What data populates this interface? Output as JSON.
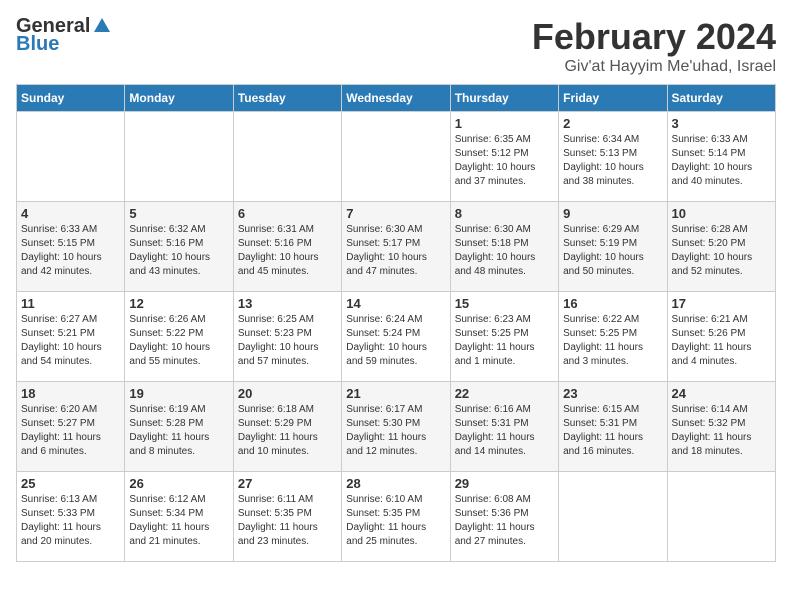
{
  "logo": {
    "general": "General",
    "blue": "Blue"
  },
  "title": {
    "month": "February 2024",
    "location": "Giv'at Hayyim Me'uhad, Israel"
  },
  "columns": [
    "Sunday",
    "Monday",
    "Tuesday",
    "Wednesday",
    "Thursday",
    "Friday",
    "Saturday"
  ],
  "weeks": [
    [
      {
        "day": "",
        "text": ""
      },
      {
        "day": "",
        "text": ""
      },
      {
        "day": "",
        "text": ""
      },
      {
        "day": "",
        "text": ""
      },
      {
        "day": "1",
        "text": "Sunrise: 6:35 AM\nSunset: 5:12 PM\nDaylight: 10 hours\nand 37 minutes."
      },
      {
        "day": "2",
        "text": "Sunrise: 6:34 AM\nSunset: 5:13 PM\nDaylight: 10 hours\nand 38 minutes."
      },
      {
        "day": "3",
        "text": "Sunrise: 6:33 AM\nSunset: 5:14 PM\nDaylight: 10 hours\nand 40 minutes."
      }
    ],
    [
      {
        "day": "4",
        "text": "Sunrise: 6:33 AM\nSunset: 5:15 PM\nDaylight: 10 hours\nand 42 minutes."
      },
      {
        "day": "5",
        "text": "Sunrise: 6:32 AM\nSunset: 5:16 PM\nDaylight: 10 hours\nand 43 minutes."
      },
      {
        "day": "6",
        "text": "Sunrise: 6:31 AM\nSunset: 5:16 PM\nDaylight: 10 hours\nand 45 minutes."
      },
      {
        "day": "7",
        "text": "Sunrise: 6:30 AM\nSunset: 5:17 PM\nDaylight: 10 hours\nand 47 minutes."
      },
      {
        "day": "8",
        "text": "Sunrise: 6:30 AM\nSunset: 5:18 PM\nDaylight: 10 hours\nand 48 minutes."
      },
      {
        "day": "9",
        "text": "Sunrise: 6:29 AM\nSunset: 5:19 PM\nDaylight: 10 hours\nand 50 minutes."
      },
      {
        "day": "10",
        "text": "Sunrise: 6:28 AM\nSunset: 5:20 PM\nDaylight: 10 hours\nand 52 minutes."
      }
    ],
    [
      {
        "day": "11",
        "text": "Sunrise: 6:27 AM\nSunset: 5:21 PM\nDaylight: 10 hours\nand 54 minutes."
      },
      {
        "day": "12",
        "text": "Sunrise: 6:26 AM\nSunset: 5:22 PM\nDaylight: 10 hours\nand 55 minutes."
      },
      {
        "day": "13",
        "text": "Sunrise: 6:25 AM\nSunset: 5:23 PM\nDaylight: 10 hours\nand 57 minutes."
      },
      {
        "day": "14",
        "text": "Sunrise: 6:24 AM\nSunset: 5:24 PM\nDaylight: 10 hours\nand 59 minutes."
      },
      {
        "day": "15",
        "text": "Sunrise: 6:23 AM\nSunset: 5:25 PM\nDaylight: 11 hours\nand 1 minute."
      },
      {
        "day": "16",
        "text": "Sunrise: 6:22 AM\nSunset: 5:25 PM\nDaylight: 11 hours\nand 3 minutes."
      },
      {
        "day": "17",
        "text": "Sunrise: 6:21 AM\nSunset: 5:26 PM\nDaylight: 11 hours\nand 4 minutes."
      }
    ],
    [
      {
        "day": "18",
        "text": "Sunrise: 6:20 AM\nSunset: 5:27 PM\nDaylight: 11 hours\nand 6 minutes."
      },
      {
        "day": "19",
        "text": "Sunrise: 6:19 AM\nSunset: 5:28 PM\nDaylight: 11 hours\nand 8 minutes."
      },
      {
        "day": "20",
        "text": "Sunrise: 6:18 AM\nSunset: 5:29 PM\nDaylight: 11 hours\nand 10 minutes."
      },
      {
        "day": "21",
        "text": "Sunrise: 6:17 AM\nSunset: 5:30 PM\nDaylight: 11 hours\nand 12 minutes."
      },
      {
        "day": "22",
        "text": "Sunrise: 6:16 AM\nSunset: 5:31 PM\nDaylight: 11 hours\nand 14 minutes."
      },
      {
        "day": "23",
        "text": "Sunrise: 6:15 AM\nSunset: 5:31 PM\nDaylight: 11 hours\nand 16 minutes."
      },
      {
        "day": "24",
        "text": "Sunrise: 6:14 AM\nSunset: 5:32 PM\nDaylight: 11 hours\nand 18 minutes."
      }
    ],
    [
      {
        "day": "25",
        "text": "Sunrise: 6:13 AM\nSunset: 5:33 PM\nDaylight: 11 hours\nand 20 minutes."
      },
      {
        "day": "26",
        "text": "Sunrise: 6:12 AM\nSunset: 5:34 PM\nDaylight: 11 hours\nand 21 minutes."
      },
      {
        "day": "27",
        "text": "Sunrise: 6:11 AM\nSunset: 5:35 PM\nDaylight: 11 hours\nand 23 minutes."
      },
      {
        "day": "28",
        "text": "Sunrise: 6:10 AM\nSunset: 5:35 PM\nDaylight: 11 hours\nand 25 minutes."
      },
      {
        "day": "29",
        "text": "Sunrise: 6:08 AM\nSunset: 5:36 PM\nDaylight: 11 hours\nand 27 minutes."
      },
      {
        "day": "",
        "text": ""
      },
      {
        "day": "",
        "text": ""
      }
    ]
  ]
}
